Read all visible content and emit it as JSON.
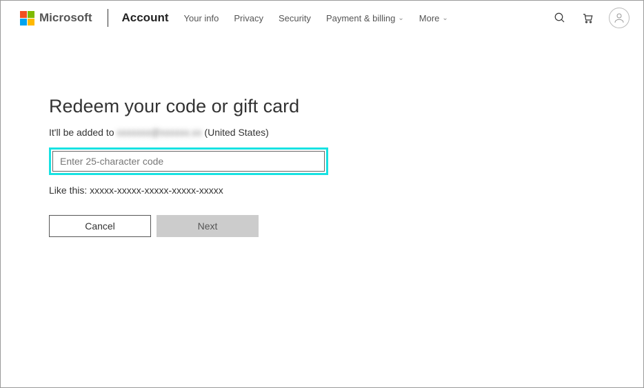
{
  "header": {
    "brand": "Microsoft",
    "heading": "Account",
    "nav": {
      "your_info": "Your info",
      "privacy": "Privacy",
      "security": "Security",
      "payment": "Payment & billing",
      "more": "More"
    }
  },
  "main": {
    "title": "Redeem your code or gift card",
    "subtitle_prefix": "It'll be added to ",
    "account_email": "xxxxxxx@xxxxxx.xx",
    "subtitle_suffix": " (United States)",
    "input_placeholder": "Enter 25-character code",
    "hint": "Like this: xxxxx-xxxxx-xxxxx-xxxxx-xxxxx",
    "cancel_label": "Cancel",
    "next_label": "Next"
  }
}
